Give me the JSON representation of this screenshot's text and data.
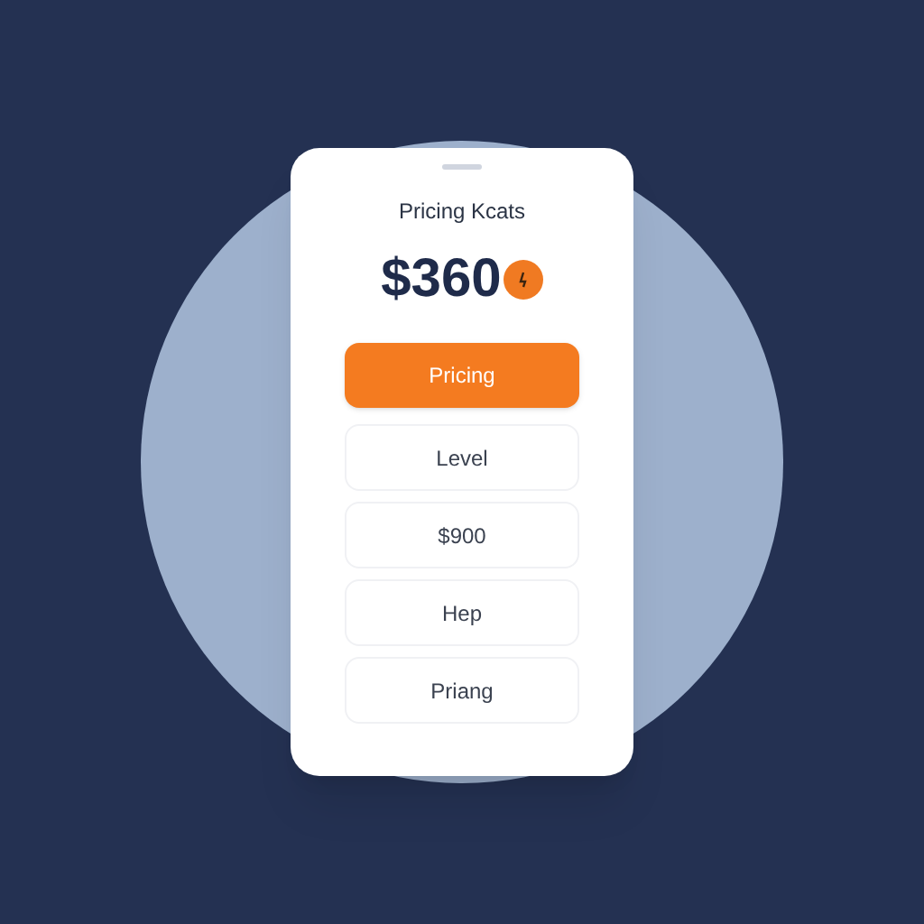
{
  "title": "Pricing Kcats",
  "price": "$360",
  "options": [
    {
      "label": "Pricing",
      "selected": true
    },
    {
      "label": "Level",
      "selected": false
    },
    {
      "label": "$900",
      "selected": false
    },
    {
      "label": "Hep",
      "selected": false
    },
    {
      "label": "Priang",
      "selected": false
    }
  ]
}
